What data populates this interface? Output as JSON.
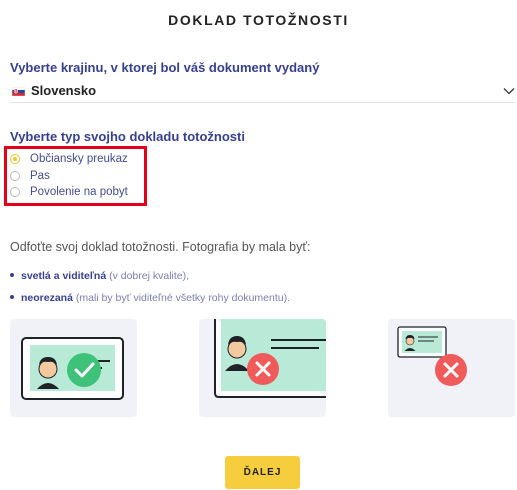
{
  "page": {
    "title": "DOKLAD TOTOŽNOSTI"
  },
  "country": {
    "label": "Vyberte krajinu, v ktorej bol váš dokument vydaný",
    "selected": "Slovensko",
    "flag_icon": "slovakia-flag-icon"
  },
  "doc_type": {
    "label": "Vyberte typ svojho dokladu totožnosti",
    "options": [
      {
        "label": "Občiansky preukaz",
        "checked": true
      },
      {
        "label": "Pas",
        "checked": false
      },
      {
        "label": "Povolenie na pobyt",
        "checked": false
      }
    ],
    "highlight_color": "#e3001b"
  },
  "instructions": {
    "text": "Odfoťte svoj doklad totožnosti. Fotografia by mala byť:",
    "bullets": [
      {
        "strong": "svetlá a viditeľná",
        "muted": " (v dobrej kvalite),"
      },
      {
        "strong": "neorezaná",
        "muted": " (mali by byť viditeľné všetky rohy dokumentu)."
      }
    ]
  },
  "examples": [
    {
      "status": "correct",
      "icon": "check-icon"
    },
    {
      "status": "incorrect",
      "icon": "cross-icon",
      "reason": "cropped"
    },
    {
      "status": "incorrect",
      "icon": "cross-icon",
      "reason": "too-small"
    }
  ],
  "actions": {
    "next_label": "ĎALEJ"
  },
  "colors": {
    "primary": "#36408f",
    "accent": "#f5cd3d",
    "card_green": "#b8ead7",
    "success": "#3ec27a",
    "error": "#ef5b5b"
  }
}
